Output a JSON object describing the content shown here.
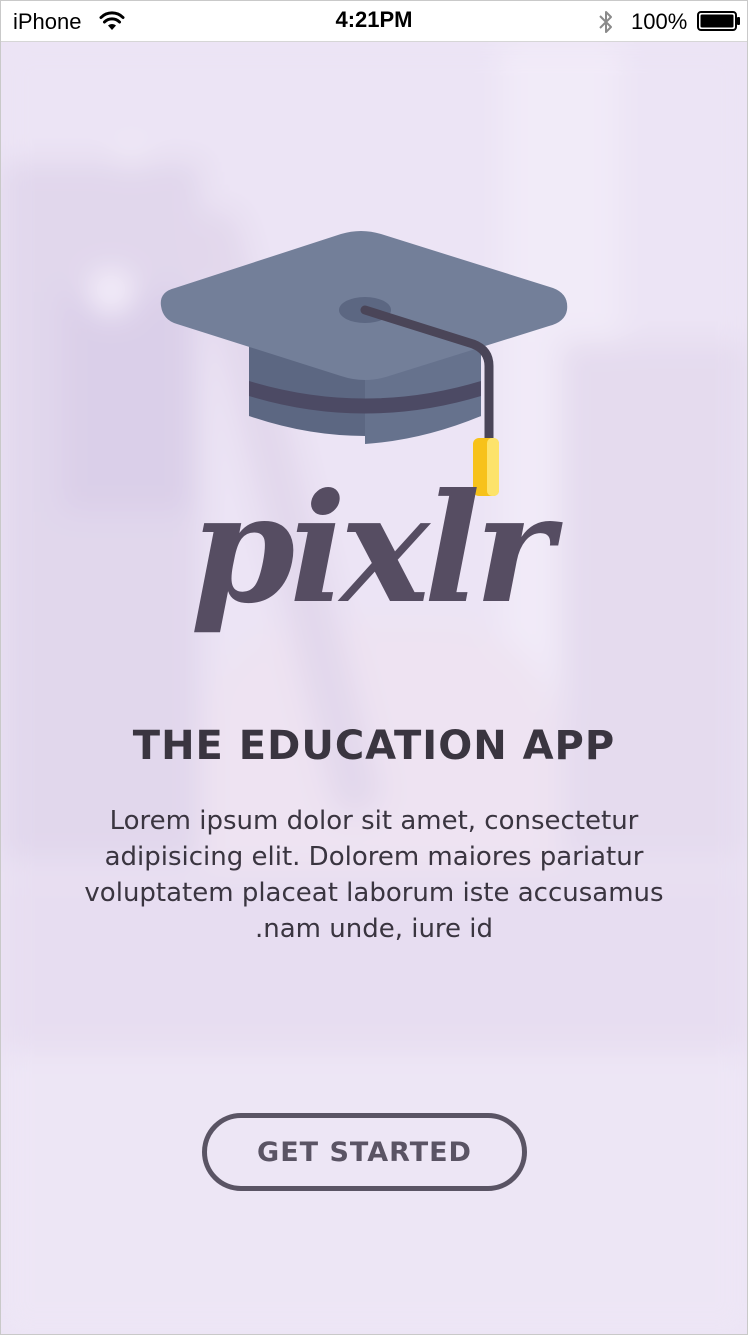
{
  "status_bar": {
    "carrier": "iPhone",
    "time": "4:21PM",
    "battery_percent": "100%",
    "battery_level": 1.0,
    "icons": [
      "wifi-icon",
      "bluetooth-icon",
      "battery-icon"
    ]
  },
  "logo": {
    "icon": "graduation-cap-icon",
    "wordmark": "pixlr"
  },
  "hero": {
    "title": "THE EDUCATION APP",
    "description": "Lorem ipsum dolor sit amet, consectetur\nadipisicing elit. Dolorem maiores pariatur\nvoluptatem placeat laborum iste accusamus\n.nam unde, iure id"
  },
  "actions": {
    "get_started_label": "GET STARTED"
  },
  "colors": {
    "background_tint": "#ece4f5",
    "text_dark": "#3a3540",
    "button_outline": "#5a5464",
    "cap_top": "#737f99",
    "cap_band": "#5c6782",
    "tassel": "#f7c21a"
  }
}
